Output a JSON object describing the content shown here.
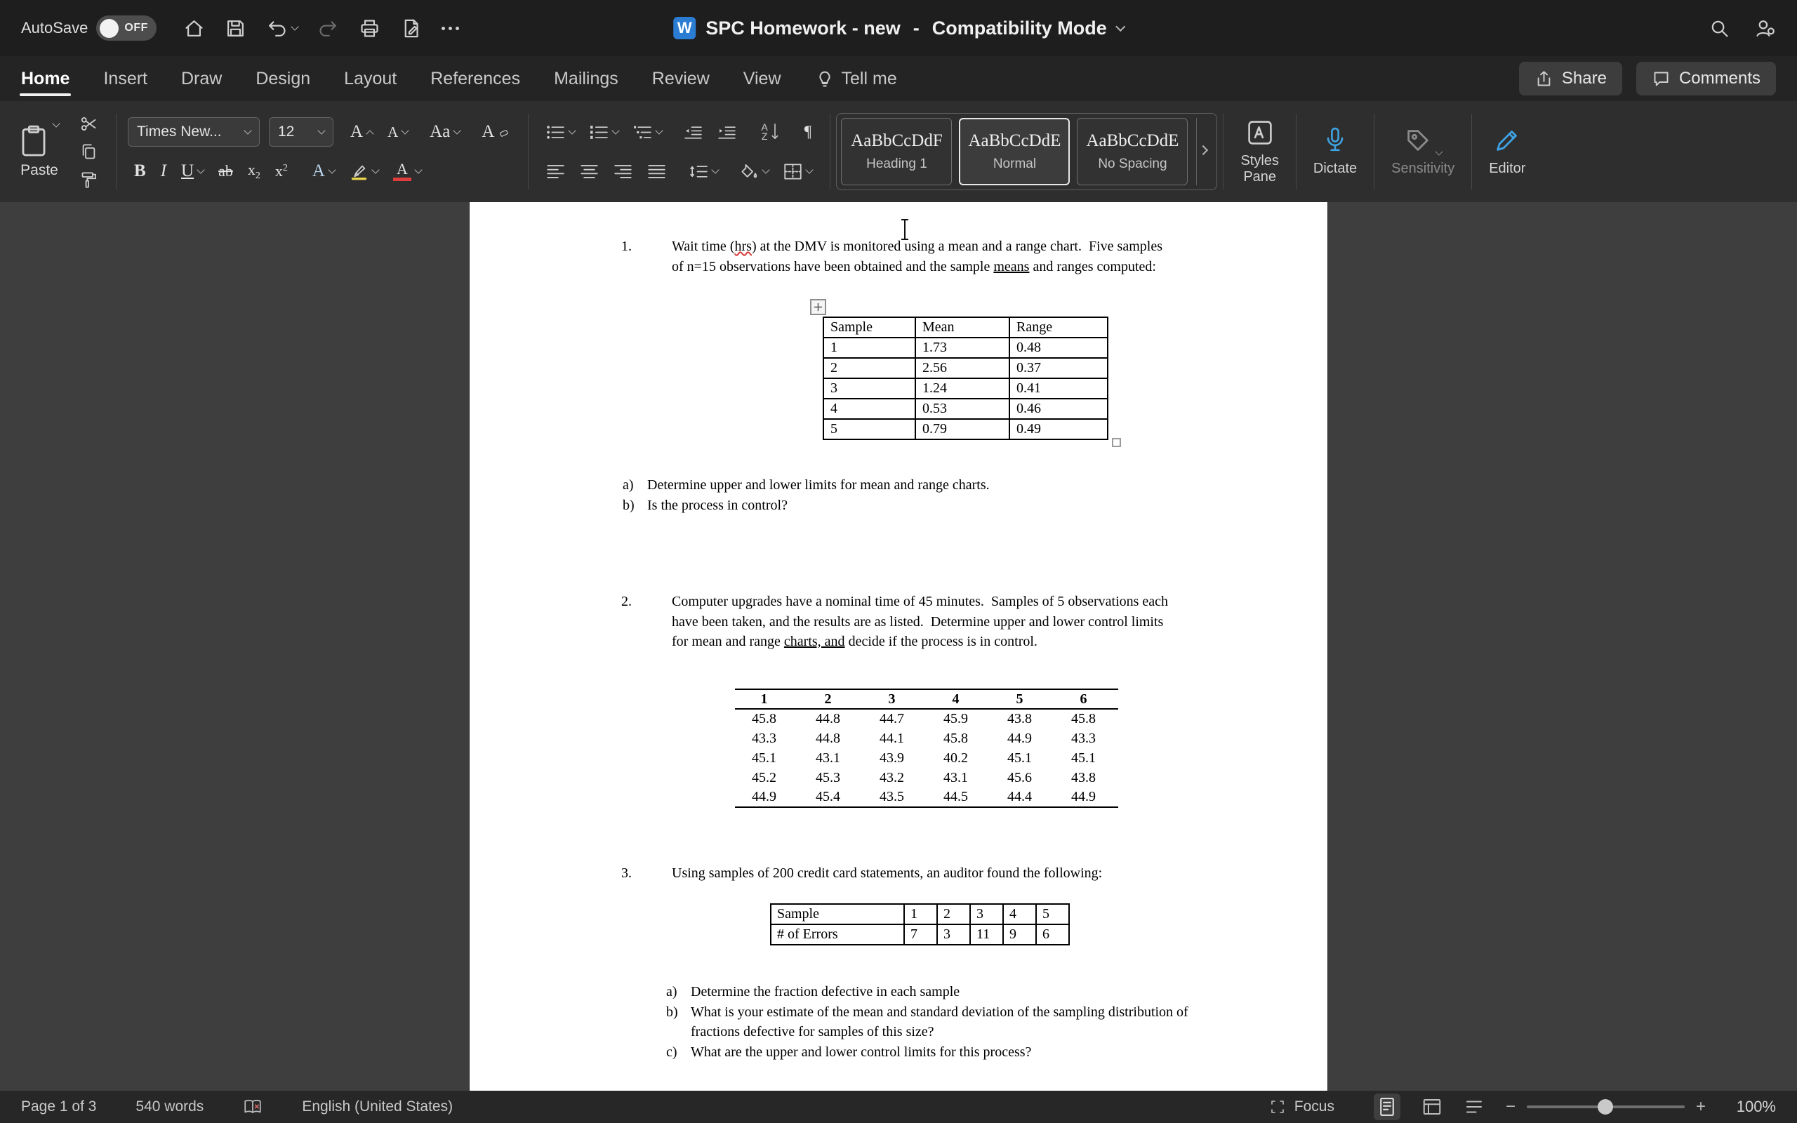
{
  "titlebar": {
    "autosave_label": "AutoSave",
    "autosave_state": "OFF",
    "app_icon_letter": "W",
    "doc_title": "SPC Homework - new",
    "title_separator": "-",
    "doc_mode": "Compatibility Mode"
  },
  "tabs": {
    "items": [
      "Home",
      "Insert",
      "Draw",
      "Design",
      "Layout",
      "References",
      "Mailings",
      "Review",
      "View"
    ],
    "tellme_label": "Tell me",
    "share_label": "Share",
    "comments_label": "Comments"
  },
  "ribbon": {
    "paste_label": "Paste",
    "font_name": "Times New...",
    "font_size": "12",
    "letters": {
      "bold": "B",
      "italic": "I",
      "underline": "U",
      "strike": "ab",
      "sub_x": "x",
      "sub_n": "2",
      "sup_x": "x",
      "sup_n": "2",
      "grow": "A",
      "shrink": "A",
      "case": "Aa",
      "clear": "A",
      "effects": "A",
      "color": "A",
      "sort_a": "A",
      "sort_z": "Z",
      "pilcrow": "¶"
    },
    "styles": [
      {
        "preview": "AaBbCcDdF",
        "name": "Heading 1"
      },
      {
        "preview": "AaBbCcDdE",
        "name": "Normal"
      },
      {
        "preview": "AaBbCcDdE",
        "name": "No Spacing"
      }
    ],
    "styles_pane_line1": "Styles",
    "styles_pane_line2": "Pane",
    "dictate_label": "Dictate",
    "sensitivity_label": "Sensitivity",
    "editor_label": "Editor"
  },
  "document": {
    "q1": {
      "number": "1.",
      "part1": "Wait time (",
      "misspelled": "hrs",
      "part2": ") at the DMV is monitored using a mean and a range chart.  Five samples of n=15 observations have been obtained and the sample ",
      "underlined": "means",
      "part3": " and ranges computed:"
    },
    "table1": {
      "headers": [
        "Sample",
        "Mean",
        "Range"
      ],
      "rows": [
        [
          "1",
          "1.73",
          "0.48"
        ],
        [
          "2",
          "2.56",
          "0.37"
        ],
        [
          "3",
          "1.24",
          "0.41"
        ],
        [
          "4",
          "0.53",
          "0.46"
        ],
        [
          "5",
          "0.79",
          "0.49"
        ]
      ]
    },
    "q1_items": [
      {
        "letter": "a)",
        "text": "Determine upper and lower limits for mean and range charts."
      },
      {
        "letter": "b)",
        "text": "Is the process in control?"
      }
    ],
    "q2": {
      "number": "2.",
      "part1": "Computer upgrades have a nominal time of 45 minutes.  Samples of 5 observations each have been taken, and the results are as listed.  Determine upper and lower control limits for mean and range ",
      "underlined": "charts, and",
      "part2": " decide if the process is in control."
    },
    "table2": {
      "headers": [
        "1",
        "2",
        "3",
        "4",
        "5",
        "6"
      ],
      "rows": [
        [
          "45.8",
          "44.8",
          "44.7",
          "45.9",
          "43.8",
          "45.8"
        ],
        [
          "43.3",
          "44.8",
          "44.1",
          "45.8",
          "44.9",
          "43.3"
        ],
        [
          "45.1",
          "43.1",
          "43.9",
          "40.2",
          "45.1",
          "45.1"
        ],
        [
          "45.2",
          "45.3",
          "43.2",
          "43.1",
          "45.6",
          "43.8"
        ],
        [
          "44.9",
          "45.4",
          "43.5",
          "44.5",
          "44.4",
          "44.9"
        ]
      ]
    },
    "q3": {
      "number": "3.",
      "text": "Using samples of 200 credit card statements, an auditor found the following:"
    },
    "table3": {
      "rows": [
        [
          "Sample",
          "1",
          "2",
          "3",
          "4",
          "5"
        ],
        [
          "# of Errors",
          "7",
          "3",
          "11",
          "9",
          "6"
        ]
      ]
    },
    "q3_items": [
      {
        "letter": "a)",
        "text": "Determine the fraction defective in each sample"
      },
      {
        "letter": "b)",
        "text": "What is your estimate of the mean and standard deviation of the sampling distribution of fractions defective for samples of this size?"
      },
      {
        "letter": "c)",
        "text": "What are the upper and lower control limits for this process?"
      }
    ]
  },
  "statusbar": {
    "page_info": "Page 1 of 3",
    "word_count": "540 words",
    "language": "English (United States)",
    "focus_label": "Focus",
    "zoom_out": "−",
    "zoom_in": "+",
    "zoom_level": "100%"
  }
}
